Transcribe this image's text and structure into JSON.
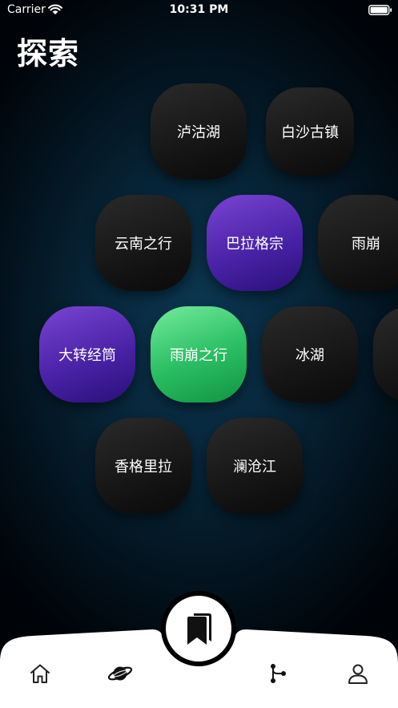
{
  "status_bar": {
    "carrier": "Carrier",
    "time": "10:31 PM"
  },
  "header": {
    "title": "探索"
  },
  "bubbles": [
    {
      "label": "泸沽湖",
      "style": "dark"
    },
    {
      "label": "白沙古镇",
      "style": "dark"
    },
    {
      "label": "云南之行",
      "style": "dark"
    },
    {
      "label": "巴拉格宗",
      "style": "purple"
    },
    {
      "label": "雨崩",
      "style": "dark"
    },
    {
      "label": "大转经筒",
      "style": "purple"
    },
    {
      "label": "雨崩之行",
      "style": "green"
    },
    {
      "label": "冰湖",
      "style": "dark"
    },
    {
      "label": "",
      "style": "dark"
    },
    {
      "label": "香格里拉",
      "style": "dark"
    },
    {
      "label": "澜沧江",
      "style": "dark"
    }
  ],
  "tab_bar": {
    "items": [
      {
        "icon": "home-icon"
      },
      {
        "icon": "planet-icon"
      },
      {
        "icon": "bookmarks-icon"
      },
      {
        "icon": "branch-icon"
      },
      {
        "icon": "user-icon"
      }
    ]
  },
  "colors": {
    "purple_start": "#7a44d2",
    "purple_end": "#2a0f78",
    "green_start": "#74eb9c",
    "green_end": "#0f9440",
    "bubble_dark": "#1a1a1a",
    "background_center": "#0c3752"
  }
}
